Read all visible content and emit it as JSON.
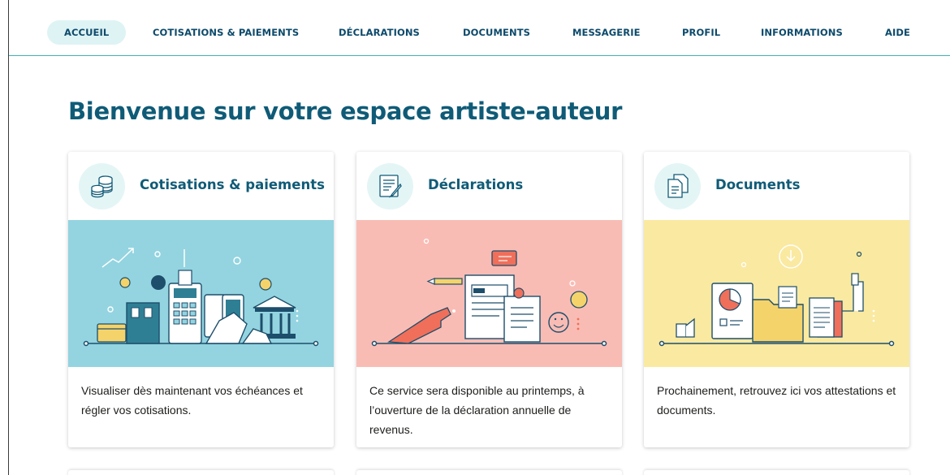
{
  "nav": {
    "items": [
      {
        "label": "ACCUEIL",
        "active": true
      },
      {
        "label": "COTISATIONS & PAIEMENTS"
      },
      {
        "label": "DÉCLARATIONS"
      },
      {
        "label": "DOCUMENTS"
      },
      {
        "label": "MESSAGERIE"
      },
      {
        "label": "PROFIL"
      },
      {
        "label": "INFORMATIONS"
      },
      {
        "label": "AIDE"
      }
    ]
  },
  "main": {
    "title": "Bienvenue sur votre espace artiste-auteur",
    "cards": [
      {
        "title": "Cotisations & paiements",
        "icon": "coins-stack-icon",
        "illustration": "payments-illustration",
        "text": "Visualiser dès maintenant vos échéances et régler vos cotisations."
      },
      {
        "title": "Déclarations",
        "icon": "form-pen-icon",
        "illustration": "declarations-illustration",
        "text": "Ce service sera disponible au printemps, à l’ouverture de la déclaration annuelle de revenus."
      },
      {
        "title": "Documents",
        "icon": "documents-icon",
        "illustration": "documents-illustration",
        "text": "Prochainement, retrouvez ici vos attestations et documents."
      }
    ]
  },
  "colors": {
    "brand": "#0f5b77",
    "nav_text": "#0d4a6b",
    "accent_line": "#3fb2b8",
    "active_pill": "#def3f4",
    "illu_blue": "#93d4e0",
    "illu_pink": "#f9bcb4",
    "illu_yellow": "#fae9a0"
  }
}
